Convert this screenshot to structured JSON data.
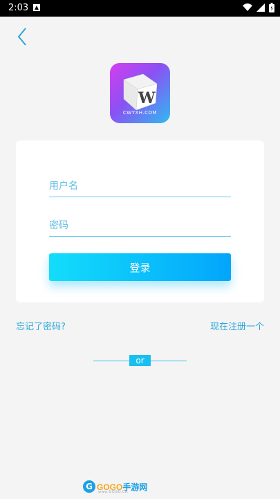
{
  "status_bar": {
    "time": "2:03",
    "notification_icon": "sim-card-icon",
    "icons": [
      "wifi-icon",
      "signal-icon",
      "battery-icon"
    ]
  },
  "nav": {
    "back_icon": "chevron-left-icon"
  },
  "logo": {
    "text": "CWYXH.COM",
    "cube_letter": "W"
  },
  "form": {
    "username_placeholder": "用户名",
    "password_placeholder": "密码",
    "login_label": "登录"
  },
  "links": {
    "forgot_password": "忘记了密码?",
    "register": "现在注册一个"
  },
  "divider": {
    "text": "or"
  },
  "watermark": {
    "brand_gogo": "GOGO",
    "brand_cn": "手游网",
    "sub": "www.GOGO.CN"
  },
  "colors": {
    "accent": "#03a5fb",
    "accent_light": "#13ddfb",
    "link": "#2aa6da",
    "background": "#f4f4f4"
  }
}
